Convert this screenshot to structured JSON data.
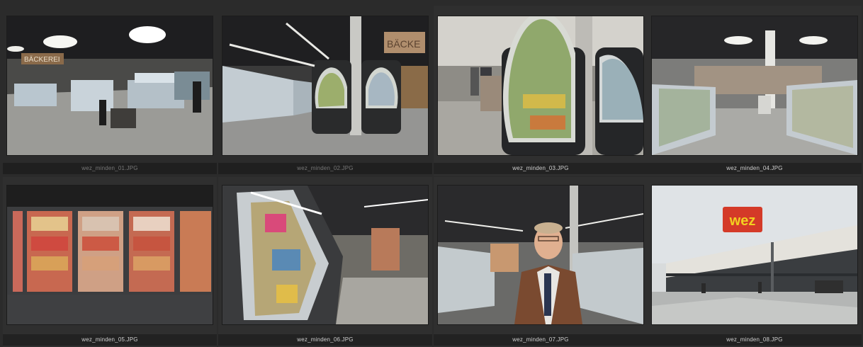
{
  "browser": {
    "thumbnails": [
      {
        "filename": "wez_minden_01.JPG",
        "selected": false
      },
      {
        "filename": "wez_minden_02.JPG",
        "selected": false
      },
      {
        "filename": "wez_minden_03.JPG",
        "selected": true
      },
      {
        "filename": "wez_minden_04.JPG",
        "selected": true
      },
      {
        "filename": "wez_minden_05.JPG",
        "selected": true
      },
      {
        "filename": "wez_minden_06.JPG",
        "selected": true
      },
      {
        "filename": "wez_minden_07.JPG",
        "selected": true
      },
      {
        "filename": "wez_minden_08.JPG",
        "selected": true
      }
    ]
  },
  "photo_text": {
    "baeckerei_sign_1": "BÄCKEREI",
    "baeckerei_sign_2": "BÄCKE",
    "store_logo": "wez"
  }
}
